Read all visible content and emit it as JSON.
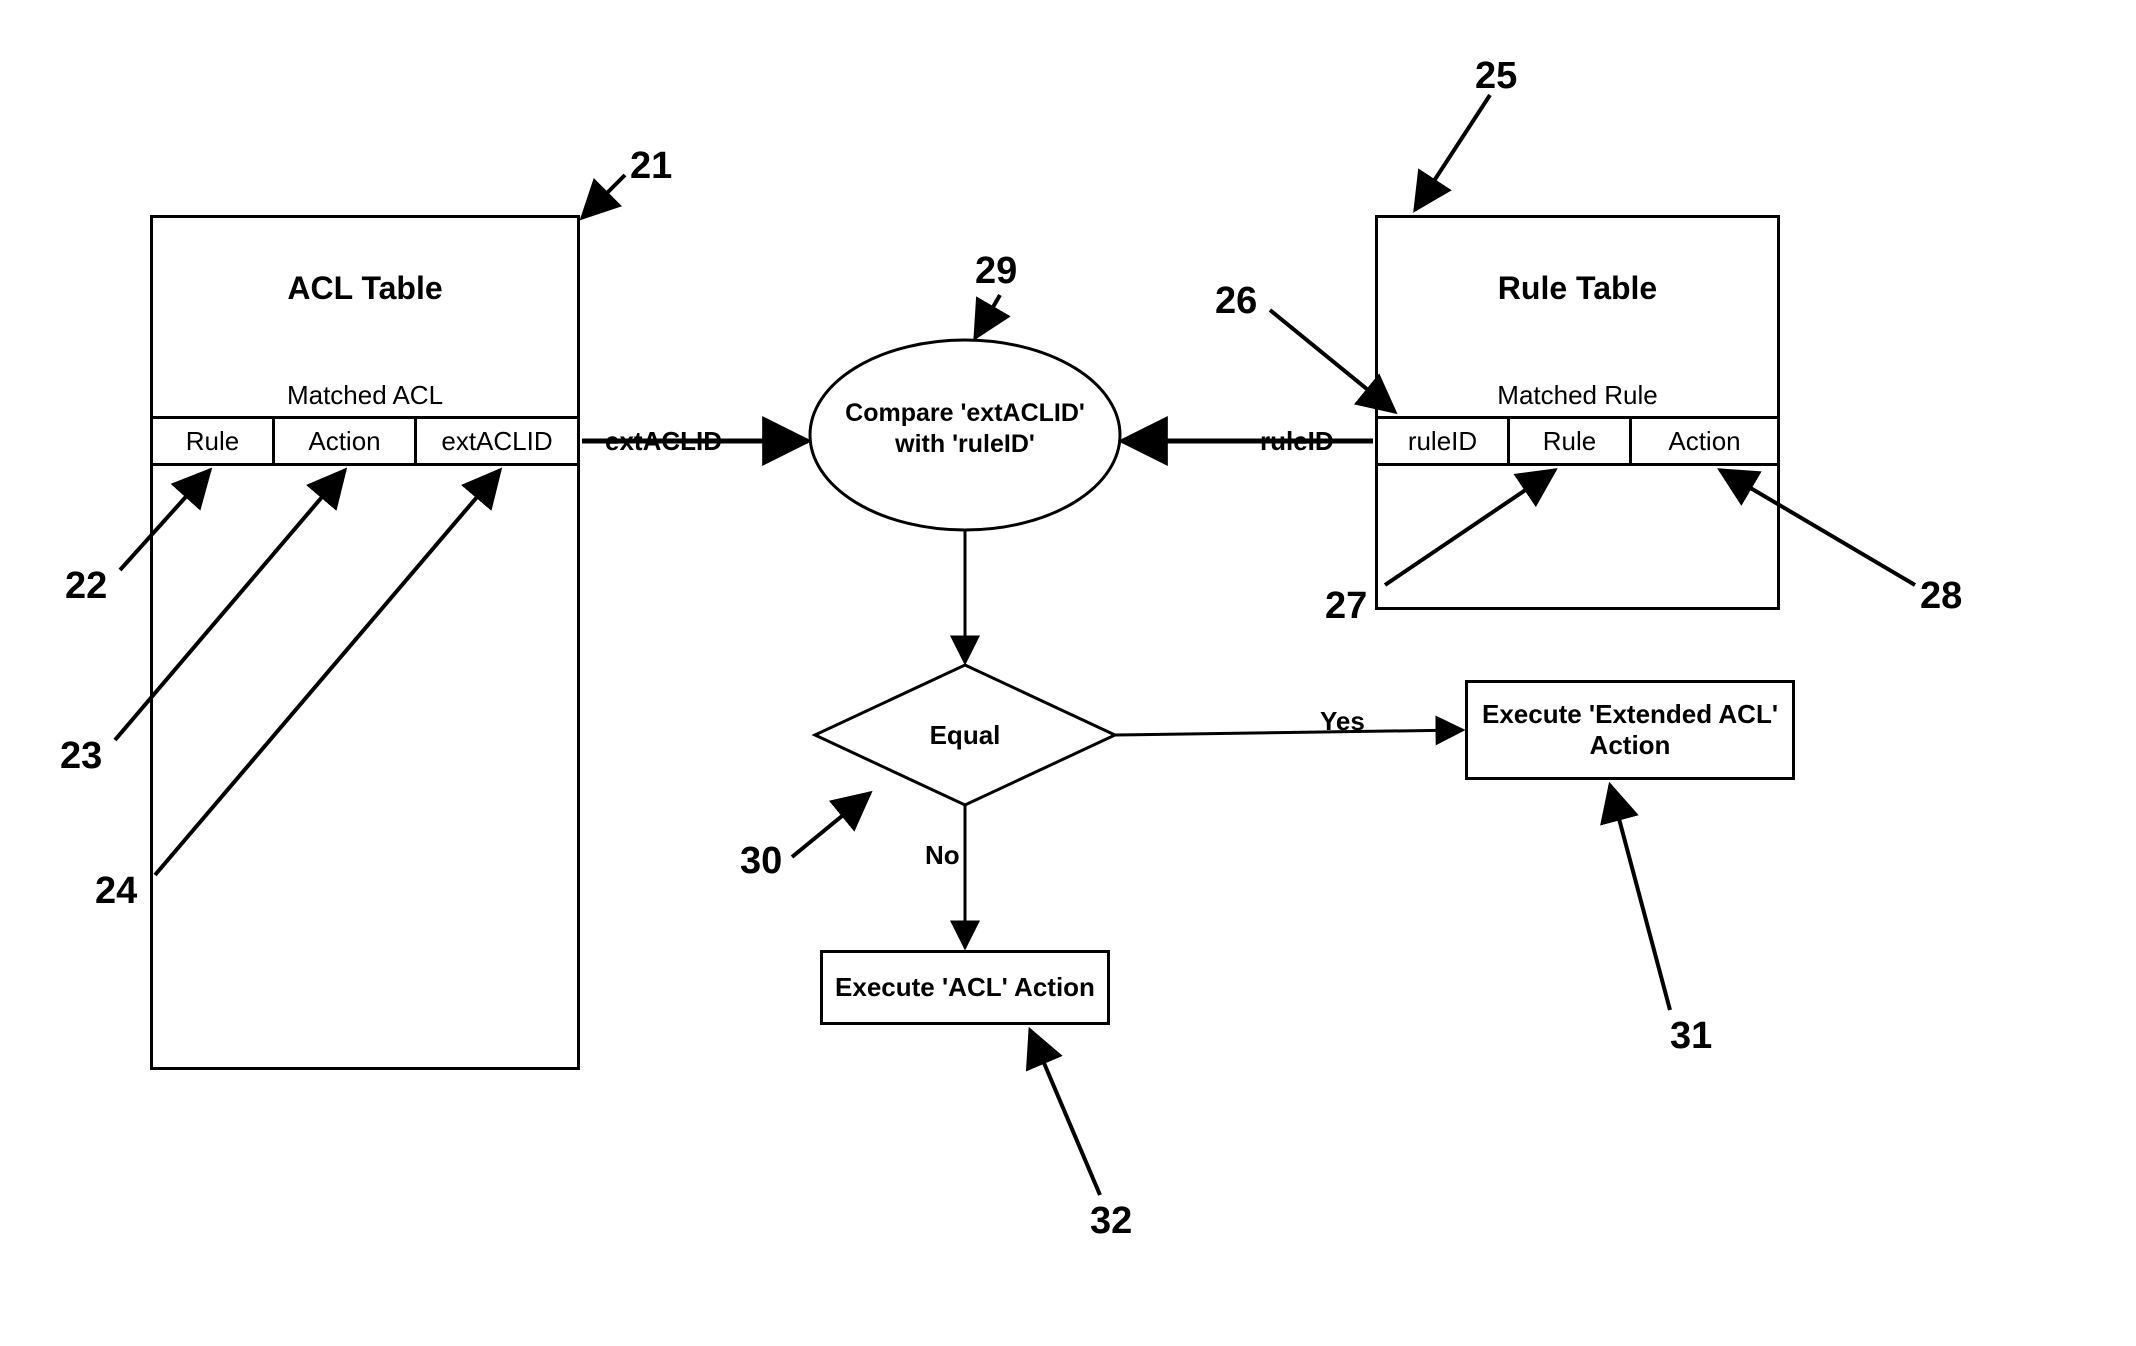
{
  "acl_table": {
    "title": "ACL Table",
    "subtitle": "Matched ACL",
    "cols": {
      "rule": "Rule",
      "action": "Action",
      "ext": "extACLID"
    }
  },
  "rule_table": {
    "title": "Rule Table",
    "subtitle": "Matched Rule",
    "cols": {
      "ruleid": "ruleID",
      "rule": "Rule",
      "action": "Action"
    }
  },
  "edges": {
    "left": "extACLID",
    "right": "ruleID",
    "yes": "Yes",
    "no": "No"
  },
  "compare": "Compare 'extACLID' with 'ruleID'",
  "decision": "Equal",
  "exec_ext": "Execute 'Extended ACL' Action",
  "exec_acl": "Execute 'ACL' Action",
  "refs": {
    "r21": "21",
    "r22": "22",
    "r23": "23",
    "r24": "24",
    "r25": "25",
    "r26": "26",
    "r27": "27",
    "r28": "28",
    "r29": "29",
    "r30": "30",
    "r31": "31",
    "r32": "32"
  }
}
